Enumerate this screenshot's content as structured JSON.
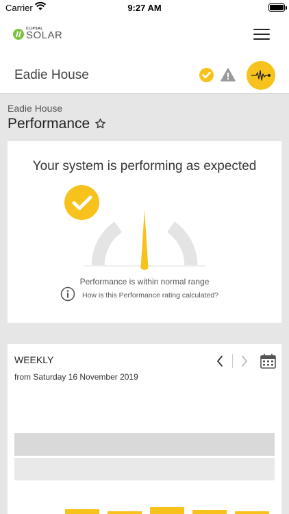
{
  "status_bar": {
    "carrier": "Carrier",
    "time": "9:27 AM"
  },
  "header": {
    "logo_small": "CLIPSAL",
    "logo_big": "SOLAR"
  },
  "site": {
    "name": "Eadie House"
  },
  "page": {
    "breadcrumb": "Eadie House",
    "title": "Performance"
  },
  "performance": {
    "headline": "Your system is performing as expected",
    "status": "Performance is within normal range",
    "info_link": "How is this Performance rating calculated?",
    "gauge_level": 0.5
  },
  "weekly": {
    "title": "WEEKLY",
    "range": "from Saturday 16 November 2019",
    "bar_fill_levels": [
      0.55,
      0.2,
      0.95,
      0.45,
      0.15
    ]
  },
  "colors": {
    "accent": "#f7c21c",
    "brand_green": "#7dc242",
    "background": "#e6e6e6"
  }
}
